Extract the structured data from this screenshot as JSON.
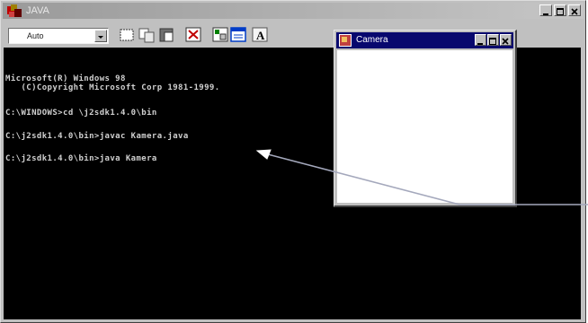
{
  "dos_window": {
    "title": "JAVA",
    "font_selector": {
      "value": "Auto"
    }
  },
  "console": {
    "lines": [
      "Microsoft(R) Windows 98",
      "   (C)Copyright Microsoft Corp 1981-1999.",
      "",
      "C:\\WINDOWS>cd \\j2sdk1.4.0\\bin",
      "",
      "C:\\j2sdk1.4.0\\bin>javac Kamera.java",
      "",
      "C:\\j2sdk1.4.0\\bin>java Kamera"
    ]
  },
  "camera_window": {
    "title": "Camera"
  },
  "colors": {
    "console_bg": "#000000",
    "console_text": "#d0d0d0",
    "active_titlebar": "#08086e",
    "inactive_titlebar": "#9a9a9a",
    "arrow": "#9aa0b4"
  }
}
